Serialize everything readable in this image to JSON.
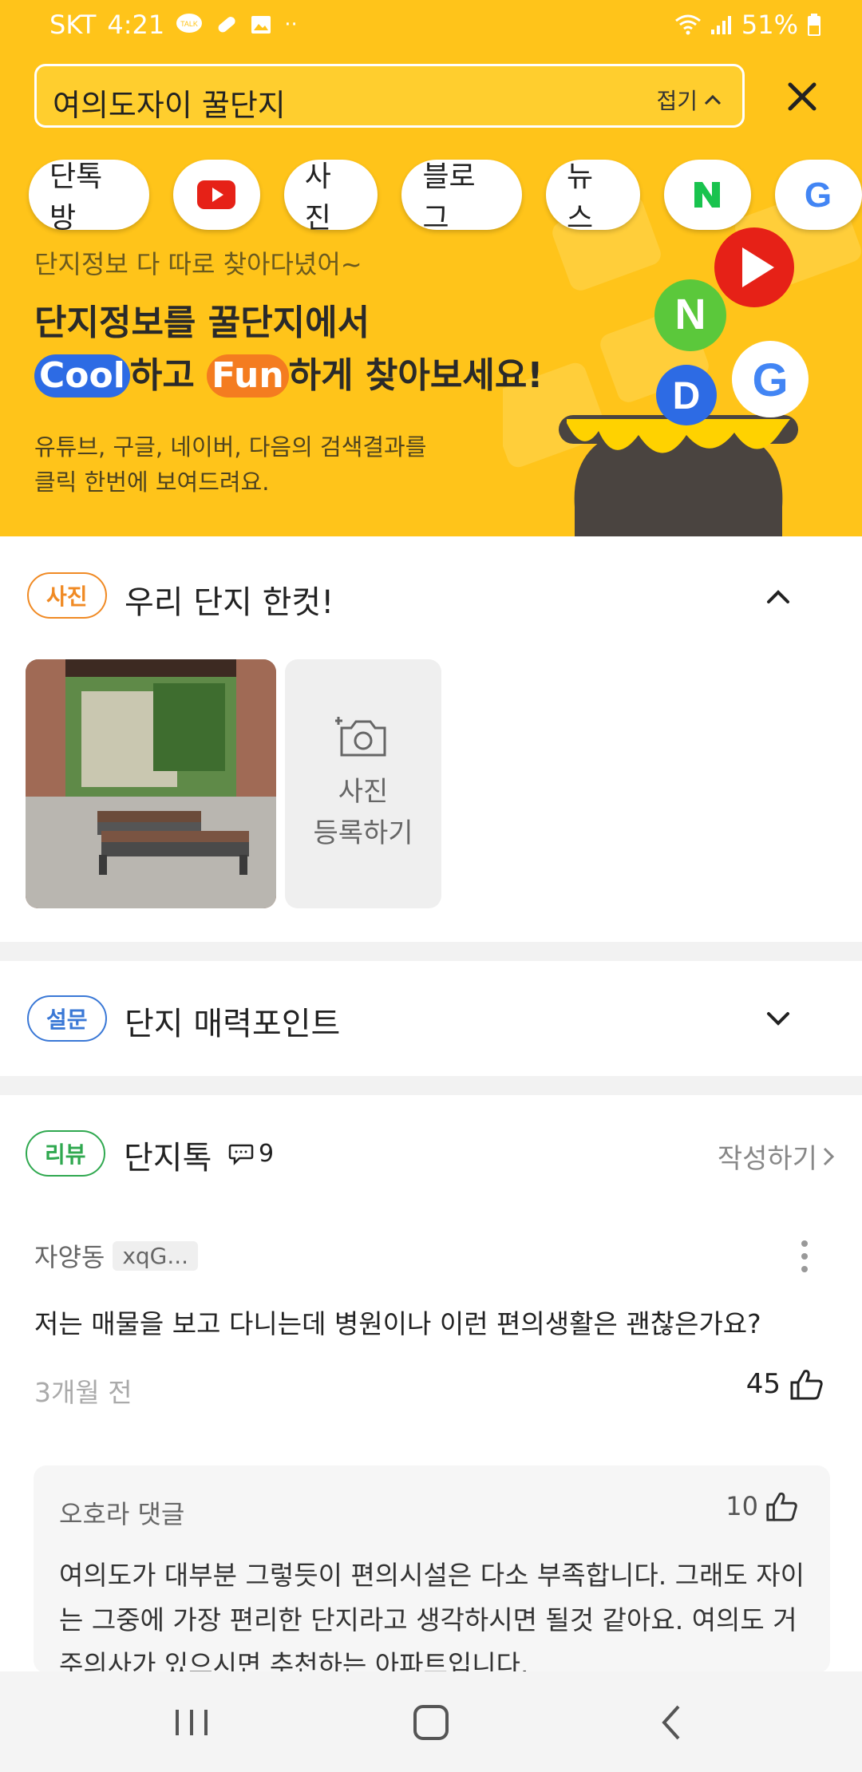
{
  "status": {
    "carrier": "SKT",
    "time": "4:21",
    "battery": "51%",
    "notif_icons": [
      "talk-icon",
      "pill-icon",
      "gallery-icon",
      "more-dots-icon"
    ],
    "right_icons": [
      "wifi-icon",
      "signal-icon",
      "battery-icon"
    ]
  },
  "search": {
    "query": "여의도자이 꿀단지",
    "fold_label": "접기"
  },
  "chips": [
    "단톡방",
    "youtube",
    "사진",
    "블로그",
    "뉴스",
    "naver",
    "google"
  ],
  "chip_labels": {
    "chat": "단톡방",
    "photo": "사진",
    "blog": "블로그",
    "news": "뉴스"
  },
  "promo": {
    "subtitle": "단지정보 다 따로 찾아다녔어~",
    "title_line1": "단지정보를 꿀단지에서",
    "cool": "Cool",
    "mid": "하고 ",
    "fun": "Fun",
    "tail": "하게 찾아보세요!",
    "desc_line1": "유튜브, 구글, 네이버, 다음의 검색결과를",
    "desc_line2": "클릭 한번에 보여드려요."
  },
  "photo_section": {
    "tag": "사진",
    "title": "우리 단지 한컷!",
    "add_line1": "사진",
    "add_line2": "등록하기"
  },
  "survey_section": {
    "tag": "설문",
    "title": "단지 매력포인트"
  },
  "review_section": {
    "tag": "리뷰",
    "title": "단지톡",
    "comment_count": "9",
    "write_label": "작성하기"
  },
  "comment": {
    "location": "자양동",
    "user": "xqG...",
    "text": "저는 매물을 보고 다니는데 병원이나 이런 편의생활은 괜찮은가요?",
    "time": "3개월 전",
    "likes": "45"
  },
  "reply": {
    "author": "오호라 댓글",
    "likes": "10",
    "text": "여의도가 대부분 그렇듯이 편의시설은 다소 부족합니다. 그래도 자이는 그중에 가장 편리한 단지라고 생각하시면 될것 같아요. 여의도 거주의사가 있으시면 추천하는 아파트입니다."
  },
  "colors": {
    "brand_yellow": "#FFC41A",
    "cool_blue": "#2D6BE4",
    "fun_orange": "#F47C20",
    "photo_tag": "#F08A24",
    "survey_tag": "#3A78D6",
    "review_tag": "#2FA84F"
  }
}
